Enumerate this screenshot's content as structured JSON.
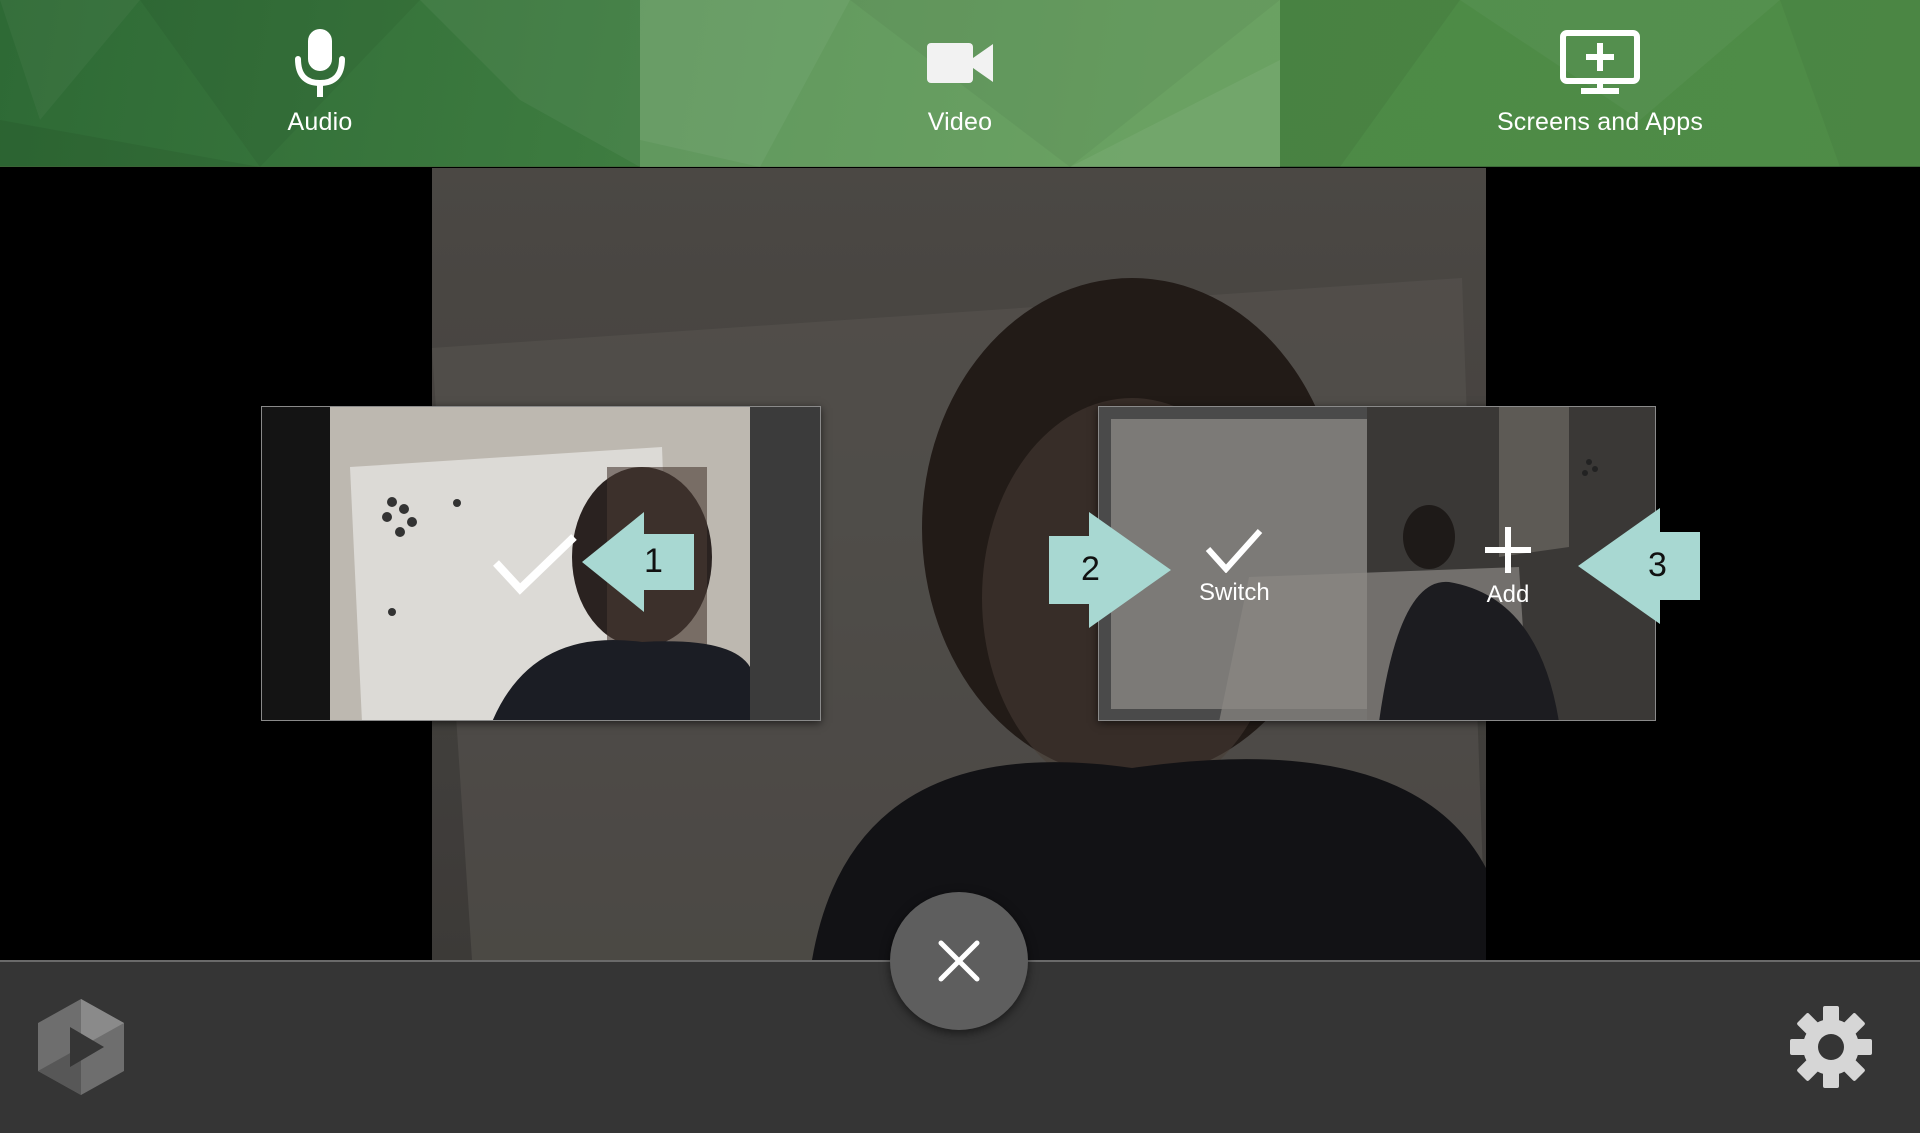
{
  "tabs": [
    {
      "label": "Audio",
      "icon": "microphone-icon",
      "selected": false
    },
    {
      "label": "Video",
      "icon": "video-camera-icon",
      "selected": true
    },
    {
      "label": "Screens and Apps",
      "icon": "screen-add-icon",
      "selected": false
    }
  ],
  "thumbnails": {
    "first": {
      "selected": true,
      "action_icon": "checkmark-icon"
    },
    "second": {
      "switch_label": "Switch",
      "add_label": "Add"
    }
  },
  "callouts": [
    "1",
    "2",
    "3"
  ],
  "colors": {
    "tab_green": "#3c7a3f",
    "callout_teal": "#a8d8d2",
    "bottom_bar": "#353535",
    "close_button": "#5e5e5e"
  },
  "icons": {
    "close": "close-icon",
    "settings": "gear-icon",
    "logo": "app-logo-icon"
  }
}
